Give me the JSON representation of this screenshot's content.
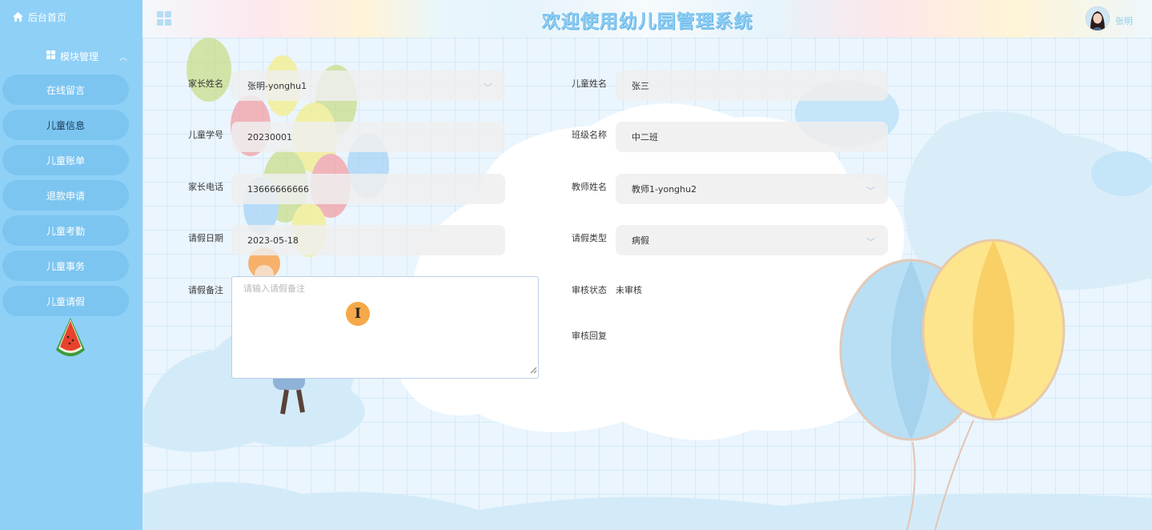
{
  "sidebar": {
    "home_label": "后台首页",
    "module_label": "模块管理",
    "items": [
      {
        "label": "在线留言"
      },
      {
        "label": "儿童信息"
      },
      {
        "label": "儿童账单"
      },
      {
        "label": "退款申请"
      },
      {
        "label": "儿童考勤"
      },
      {
        "label": "儿童事务"
      },
      {
        "label": "儿童请假"
      }
    ]
  },
  "header": {
    "title": "欢迎使用幼儿园管理系统",
    "username": "张明"
  },
  "form": {
    "parent_name": {
      "label": "家长姓名",
      "value": "张明-yonghu1"
    },
    "child_name": {
      "label": "儿童姓名",
      "value": "张三"
    },
    "student_id": {
      "label": "儿童学号",
      "value": "20230001"
    },
    "class_name": {
      "label": "班级名称",
      "value": "中二班"
    },
    "parent_phone": {
      "label": "家长电话",
      "value": "13666666666"
    },
    "teacher_name": {
      "label": "教师姓名",
      "value": "教师1-yonghu2"
    },
    "leave_date": {
      "label": "请假日期",
      "value": "2023-05-18"
    },
    "leave_type": {
      "label": "请假类型",
      "value": "病假"
    },
    "leave_note": {
      "label": "请假备注",
      "placeholder": "请输入请假备注"
    },
    "review_status": {
      "label": "审核状态",
      "value": "未审核"
    },
    "review_reply": {
      "label": "审核回复"
    }
  },
  "colors": {
    "sidebar_bg": "#8fd0f7",
    "nav_pill": "#7cc5f1",
    "title": "#8ecdf2",
    "cursor_badge": "#f5a948"
  }
}
